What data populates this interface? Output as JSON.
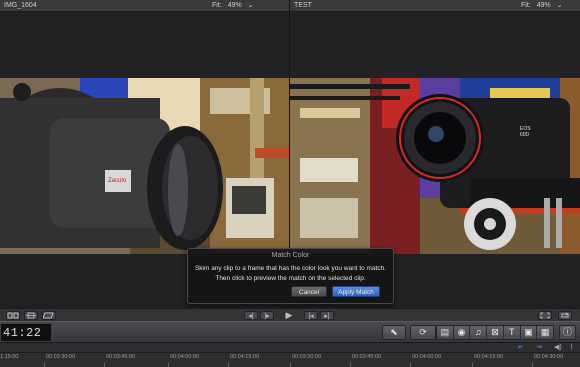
{
  "viewer_left": {
    "clip_name": "IMG_1604",
    "fit_label": "Fit:",
    "zoom": "49%",
    "chevron": "⌄"
  },
  "viewer_right": {
    "clip_name": "TEST",
    "fit_label": "Fit:",
    "zoom": "49%",
    "chevron": "⌄"
  },
  "dialog": {
    "title": "Match Color",
    "line1": "Skim any clip to a frame that has the color look you want to match.",
    "line2": "Then click to preview the match on the selected clip.",
    "cancel_label": "Cancel",
    "apply_label": "Apply Match"
  },
  "viewer_controls": {
    "left_icons": [
      "window-layout-icon",
      "transform-icon",
      "crop-icon"
    ],
    "transport": {
      "prev": "◂|",
      "next": "|▸",
      "play": "▶",
      "to_start": "|◂",
      "to_end": "▸|"
    },
    "right_icons": [
      "fullscreen-icon",
      "loop-icon"
    ]
  },
  "toolbar": {
    "timecode": "41:22",
    "tool_select": "⬉",
    "retime": "⟳",
    "media_icons": [
      "event-browser-icon",
      "photos-icon",
      "music-icon",
      "transitions-icon",
      "titles-icon",
      "generators-icon",
      "themes-icon"
    ],
    "info": "ⓘ"
  },
  "ruler": {
    "ticks": [
      "1:15:00",
      "00:03:30:00",
      "00:03:45:00",
      "00:04:00:00",
      "00:04:15:00",
      "00:03:30:00",
      "00:03:45:00",
      "00:04:00:00",
      "00:04:15:00",
      "00:04:30:00"
    ],
    "colors": {
      "zoom_icons": "#4f8ee6"
    }
  }
}
